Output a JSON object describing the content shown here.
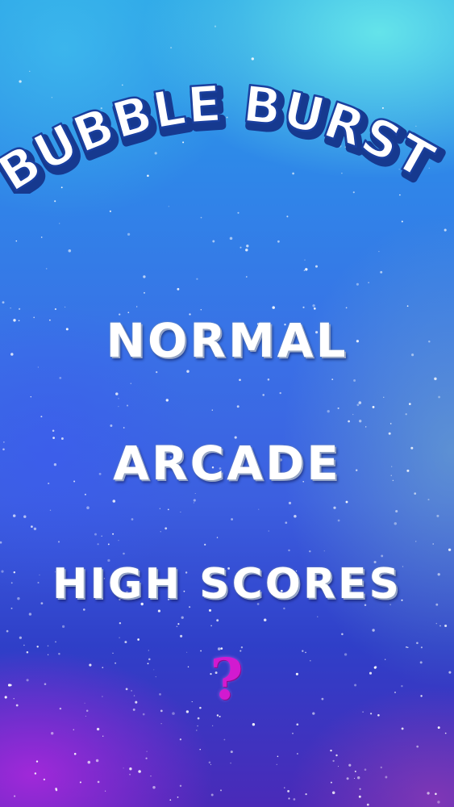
{
  "game": {
    "title": "BUBBLE BURST!"
  },
  "menu": {
    "normal_label": "NORMAL",
    "arcade_label": "ARCADE",
    "high_scores_label": "HIGH SCORES",
    "help_label": "?"
  },
  "colors": {
    "menu_text": "#ffffff",
    "title_fill": "#ffffff",
    "title_outline": "#1a3f9e",
    "help_accent": "#d21ad0"
  }
}
